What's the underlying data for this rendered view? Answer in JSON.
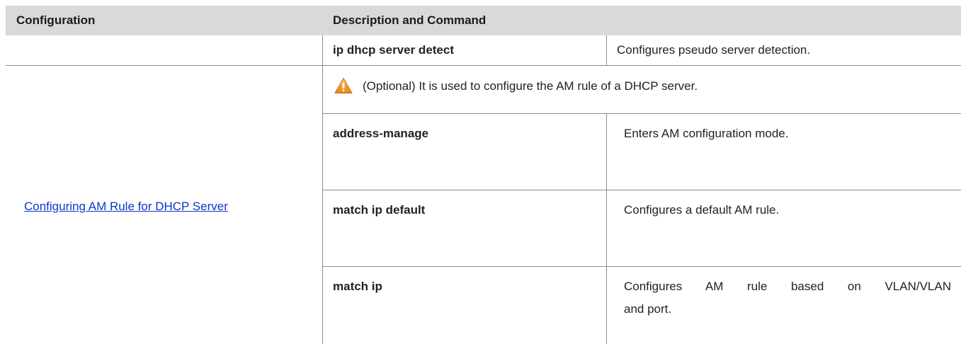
{
  "header": {
    "col1": "Configuration",
    "col2": "Description and Command"
  },
  "rows": {
    "detect": {
      "command": "ip dhcp server detect",
      "description": "Configures pseudo server detection."
    },
    "am_rule": {
      "configuration_link": "Configuring AM Rule for DHCP Server",
      "note": "(Optional) It is used to configure the AM rule of a DHCP server.",
      "note_icon": "warning-icon",
      "commands": [
        {
          "command": "address-manage",
          "description": "Enters AM configuration mode."
        },
        {
          "command": "match ip default",
          "description": "Configures a default AM rule."
        },
        {
          "command": "match ip",
          "description_line1": "Configures AM rule based on VLAN/VLAN",
          "description_line2": "and port."
        }
      ]
    }
  },
  "colors": {
    "header_bg": "#d9d9d9",
    "link": "#0b36c8",
    "warning_fill": "#f5a623",
    "border": "#8c8c8c"
  }
}
